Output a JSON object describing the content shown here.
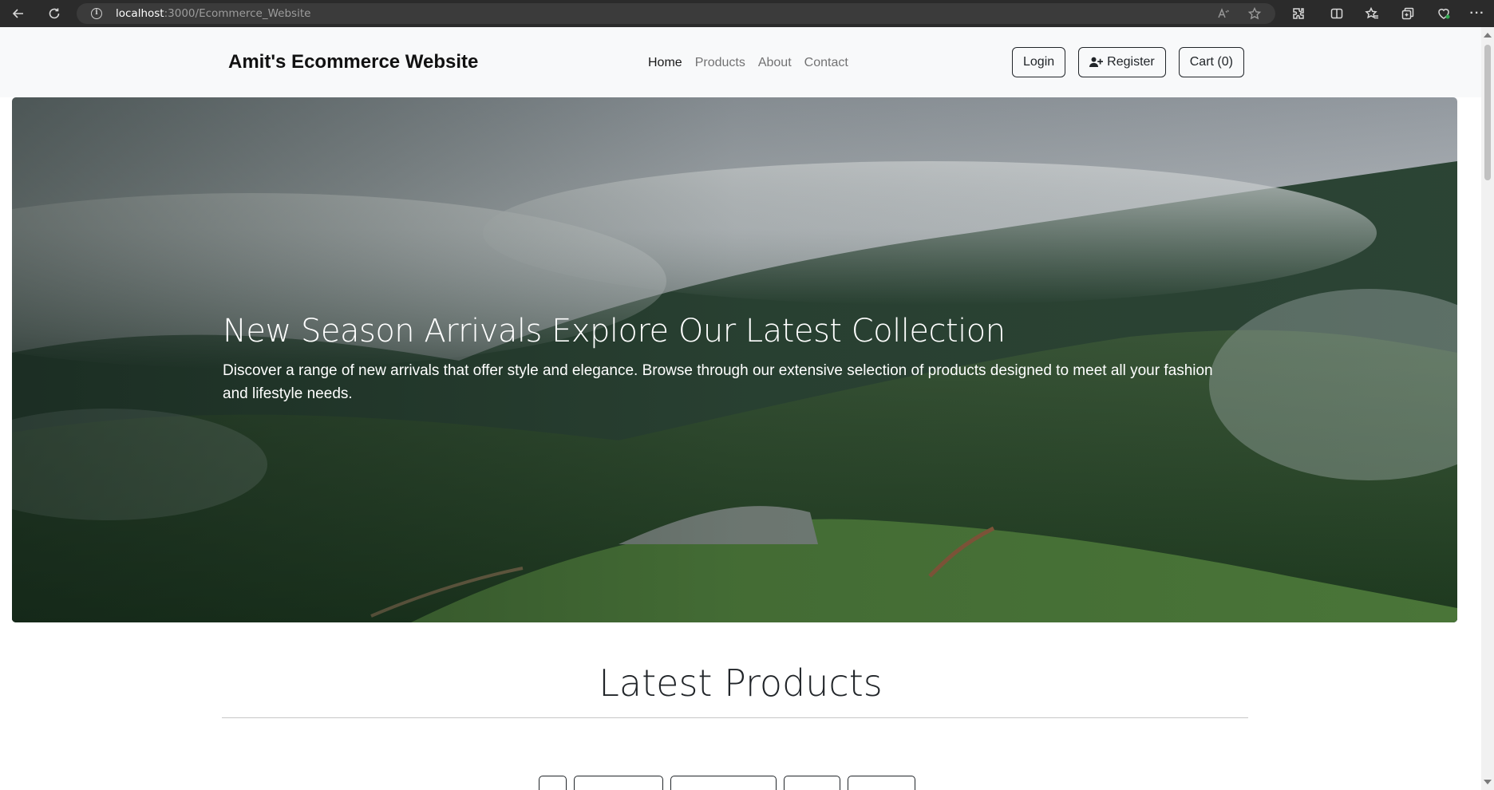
{
  "browser": {
    "url_host": "localhost",
    "url_path": ":3000/Ecommerce_Website"
  },
  "navbar": {
    "brand": "Amit's Ecommerce Website",
    "links": [
      {
        "label": "Home",
        "active": true
      },
      {
        "label": "Products",
        "active": false
      },
      {
        "label": "About",
        "active": false
      },
      {
        "label": "Contact",
        "active": false
      }
    ],
    "login_label": "Login",
    "register_label": "Register",
    "cart_label": "Cart (0)"
  },
  "hero": {
    "title": "New Season Arrivals Explore Our Latest Collection",
    "text": "Discover a range of new arrivals that offer style and elegance. Browse through our extensive selection of products designed to meet all your fashion and lifestyle needs."
  },
  "products": {
    "title": "Latest Products"
  },
  "colors": {
    "navbar_bg": "#f8f9fa",
    "text_dark": "#212529"
  }
}
